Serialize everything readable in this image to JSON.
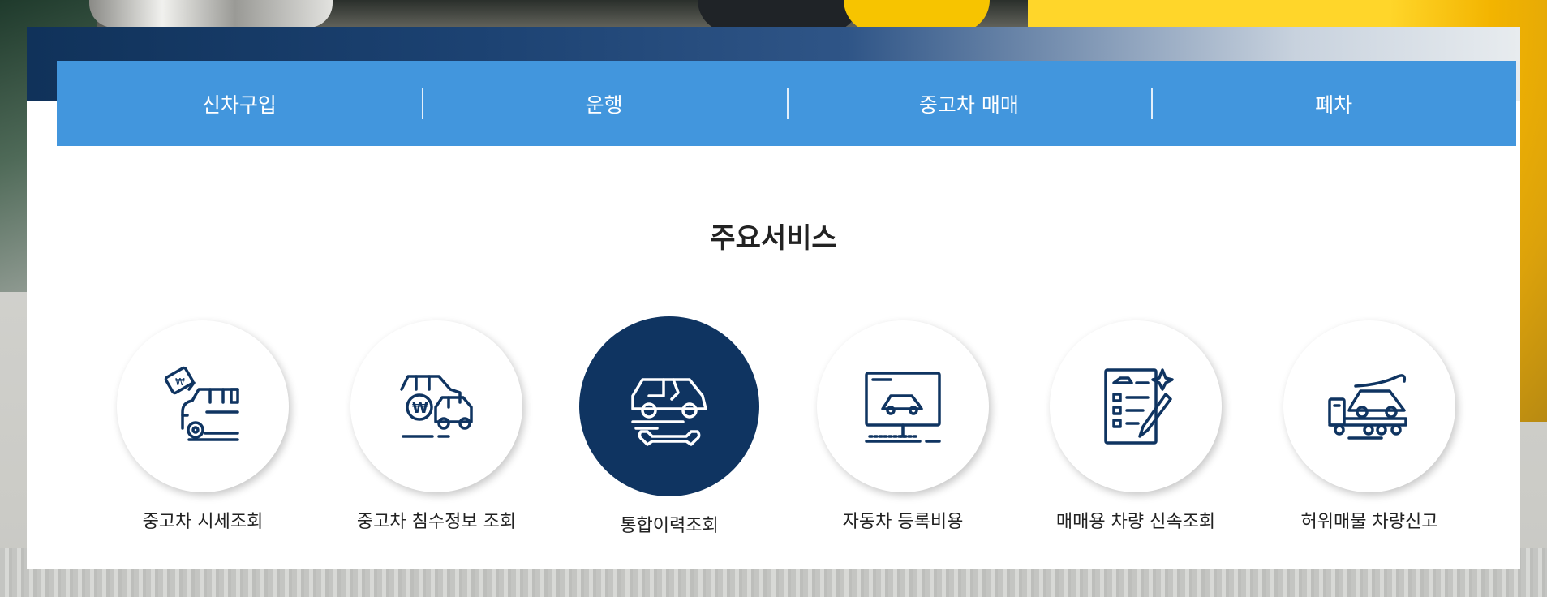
{
  "topnav": {
    "items": [
      "신차구입",
      "운행",
      "중고차 매매",
      "폐차"
    ]
  },
  "section": {
    "title": "주요서비스"
  },
  "services": [
    {
      "label": "중고차 시세조회",
      "icon": "car-price-tag-icon"
    },
    {
      "label": "중고차 침수정보 조회",
      "icon": "flooded-cars-won-icon"
    },
    {
      "label": "통합이력조회",
      "icon": "car-repair-history-icon"
    },
    {
      "label": "자동차 등록비용",
      "icon": "computer-car-registration-icon"
    },
    {
      "label": "매매용 차량 신속조회",
      "icon": "checklist-pen-icon"
    },
    {
      "label": "허위매물 차량신고",
      "icon": "tow-truck-car-icon"
    }
  ],
  "colors": {
    "nav_blue": "#4296dd",
    "icon_navy": "#0f3461",
    "active_circle": "#0f3461"
  }
}
